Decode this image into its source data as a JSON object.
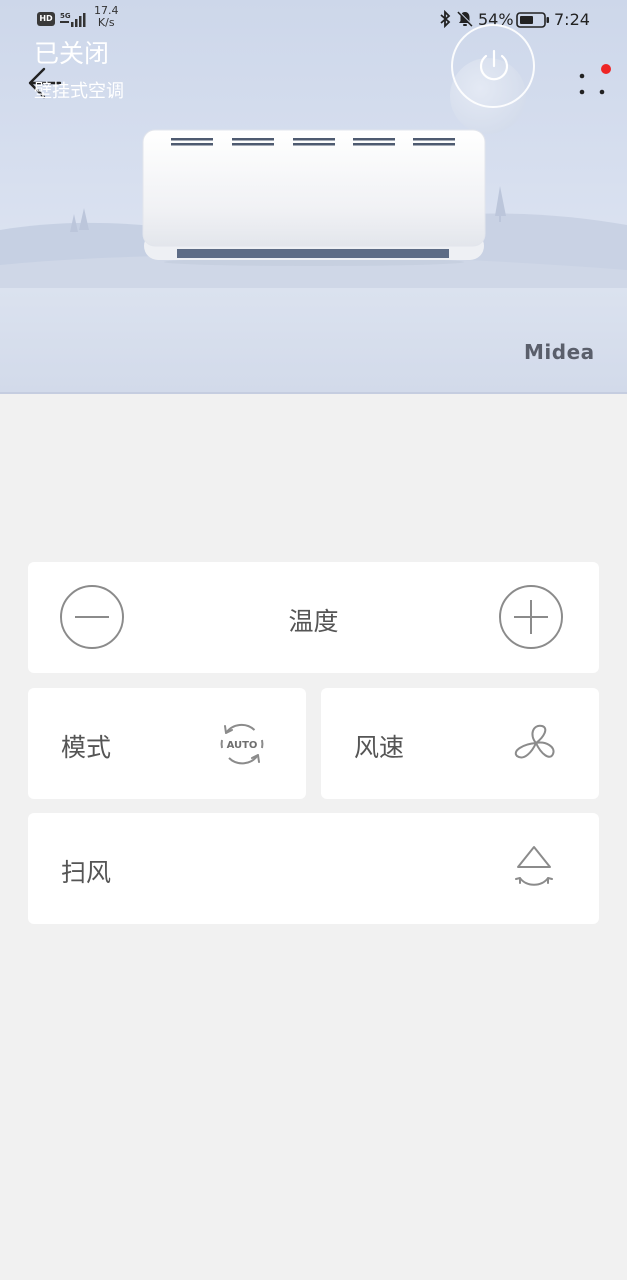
{
  "status_bar": {
    "hd": "HD",
    "network": "5G",
    "speed_value": "17.4",
    "speed_unit": "K/s",
    "battery_percent": "54%",
    "time": "7:24"
  },
  "header": {
    "back_icon": "arrow-left-icon",
    "more_icon": "more-dots-icon",
    "notification_dot_color": "#ee2525"
  },
  "hero": {
    "brand": "Midea"
  },
  "device": {
    "state": "已关闭",
    "type": "壁挂式空调",
    "power_icon": "power-icon",
    "accent_color": "#9fafcb"
  },
  "temperature": {
    "label": "温度",
    "decrease_icon": "minus-icon",
    "increase_icon": "plus-icon"
  },
  "mode": {
    "label": "模式",
    "icon": "auto-mode-icon",
    "icon_text": "AUTO"
  },
  "wind_speed": {
    "label": "风速",
    "icon": "fan-icon"
  },
  "swing": {
    "label": "扫风",
    "icon": "swing-icon"
  }
}
